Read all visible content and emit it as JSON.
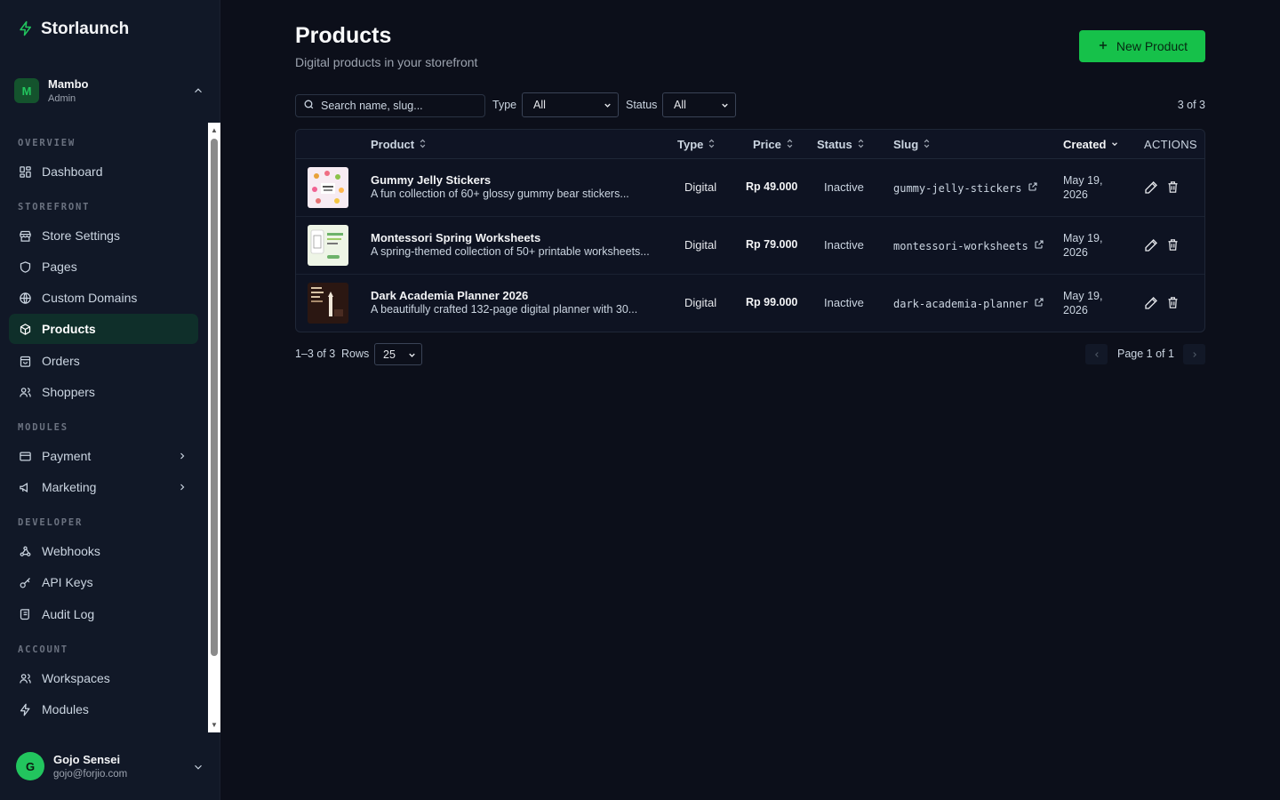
{
  "app": {
    "name": "Storlaunch"
  },
  "workspace": {
    "name": "Mambo",
    "role": "Admin",
    "initial": "M"
  },
  "sidebar": {
    "sections": {
      "overview": "OVERVIEW",
      "storefront": "STOREFRONT",
      "modules": "MODULES",
      "developer": "DEVELOPER",
      "account": "ACCOUNT"
    },
    "items": {
      "dashboard": "Dashboard",
      "store_settings": "Store Settings",
      "pages": "Pages",
      "custom_domains": "Custom Domains",
      "products": "Products",
      "orders": "Orders",
      "shoppers": "Shoppers",
      "payment": "Payment",
      "marketing": "Marketing",
      "webhooks": "Webhooks",
      "api_keys": "API Keys",
      "audit_log": "Audit Log",
      "workspaces": "Workspaces",
      "modules": "Modules"
    },
    "active": "Products"
  },
  "user": {
    "name": "Gojo Sensei",
    "email": "gojo@forjio.com",
    "initial": "G"
  },
  "header": {
    "title": "Products",
    "subtitle": "Digital products in your storefront",
    "new_button": "New Product"
  },
  "filters": {
    "search_placeholder": "Search name, slug...",
    "type_label": "Type",
    "type_value": "All",
    "status_label": "Status",
    "status_value": "All",
    "count": "3 of 3"
  },
  "table": {
    "columns": {
      "product": "Product",
      "type": "Type",
      "price": "Price",
      "status": "Status",
      "slug": "Slug",
      "created": "Created",
      "actions": "ACTIONS"
    },
    "rows": [
      {
        "name": "Gummy Jelly Stickers",
        "description": "A fun collection of 60+ glossy gummy bear stickers...",
        "type": "Digital",
        "price": "Rp 49.000",
        "status": "Inactive",
        "slug": "gummy-jelly-stickers",
        "created_line1": "May 19,",
        "created_line2": "2026"
      },
      {
        "name": "Montessori Spring Worksheets",
        "description": "A spring-themed collection of 50+ printable worksheets...",
        "type": "Digital",
        "price": "Rp 79.000",
        "status": "Inactive",
        "slug": "montessori-worksheets",
        "created_line1": "May 19,",
        "created_line2": "2026"
      },
      {
        "name": "Dark Academia Planner 2026",
        "description": "A beautifully crafted 132-page digital planner with 30...",
        "type": "Digital",
        "price": "Rp 99.000",
        "status": "Inactive",
        "slug": "dark-academia-planner",
        "created_line1": "May 19,",
        "created_line2": "2026"
      }
    ]
  },
  "footer": {
    "range": "1–3 of 3",
    "rows_label": "Rows",
    "rows_value": "25",
    "page_text": "Page 1 of 1"
  },
  "colors": {
    "accent": "#16c14a",
    "background": "#0c0f1a",
    "sidebar": "#111827",
    "active_item": "#0f2f2a"
  }
}
